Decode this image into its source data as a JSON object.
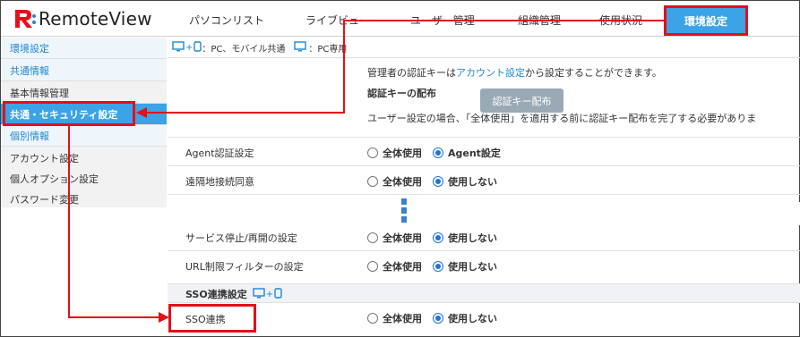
{
  "app": {
    "logo_text": "RemoteView"
  },
  "nav": {
    "items": [
      "パソコンリスト",
      "ライブビュー",
      "ユーザー管理",
      "組織管理",
      "使用状況"
    ],
    "active": "環境設定"
  },
  "sidebar": {
    "env_heading": "環境設定",
    "common_heading": "共通情報",
    "basic_info": "基本情報管理",
    "security": "共通・セキュリティ設定",
    "individual_heading": "個別情報",
    "account": "アカウント設定",
    "personal_option": "個人オプション設定",
    "password": "パスワード変更"
  },
  "legend": {
    "pc_mobile": "：PC、モバイル共通",
    "pc_only": "：PC専用"
  },
  "auth": {
    "line1_pre": "管理者の認証キーは",
    "line1_link": "アカウント設定",
    "line1_post": "から設定することができます。",
    "distribution_title": "認証キーの配布",
    "distribution_button": "認証キー配布",
    "line3": "ユーザー設定の場合、「全体使用」を適用する前に認証キー配布を完了する必要がありま"
  },
  "settings": [
    {
      "label": "Agent認証設定",
      "opt1": "全体使用",
      "opt2": "Agent設定",
      "selected": 2
    },
    {
      "label": "遠隔地接続同意",
      "opt1": "全体使用",
      "opt2": "使用しない",
      "selected": 2
    },
    {
      "label": "サービス停止/再開の設定",
      "opt1": "全体使用",
      "opt2": "使用しない",
      "selected": 2
    },
    {
      "label": "URL制限フィルターの設定",
      "opt1": "全体使用",
      "opt2": "使用しない",
      "selected": 2
    }
  ],
  "sso": {
    "section_title": "SSO連携設定",
    "label": "SSO連携",
    "opt1": "全体使用",
    "opt2": "使用しない",
    "selected": 2
  },
  "colors": {
    "accent": "#3ba3e6",
    "highlight_red": "#e3101a",
    "link": "#1e88d2"
  }
}
